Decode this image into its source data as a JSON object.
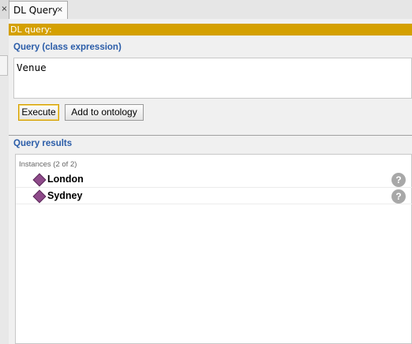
{
  "tabs": {
    "prev_close": "×",
    "active_label": "DL Query",
    "active_close": "×"
  },
  "dl_query": {
    "bar_label": "DL query:",
    "query_section_title": "Query (class expression)",
    "query_text": "Venue",
    "execute_label": "Execute",
    "add_to_ontology_label": "Add to ontology"
  },
  "results": {
    "section_title": "Query results",
    "instances_header": "Instances (2 of 2)",
    "items": [
      {
        "label": "London",
        "help": "?"
      },
      {
        "label": "Sydney",
        "help": "?"
      }
    ]
  },
  "colors": {
    "accent_bar": "#d4a000",
    "section_title": "#2a5ca8",
    "individual_icon": "#8e4a8a"
  }
}
